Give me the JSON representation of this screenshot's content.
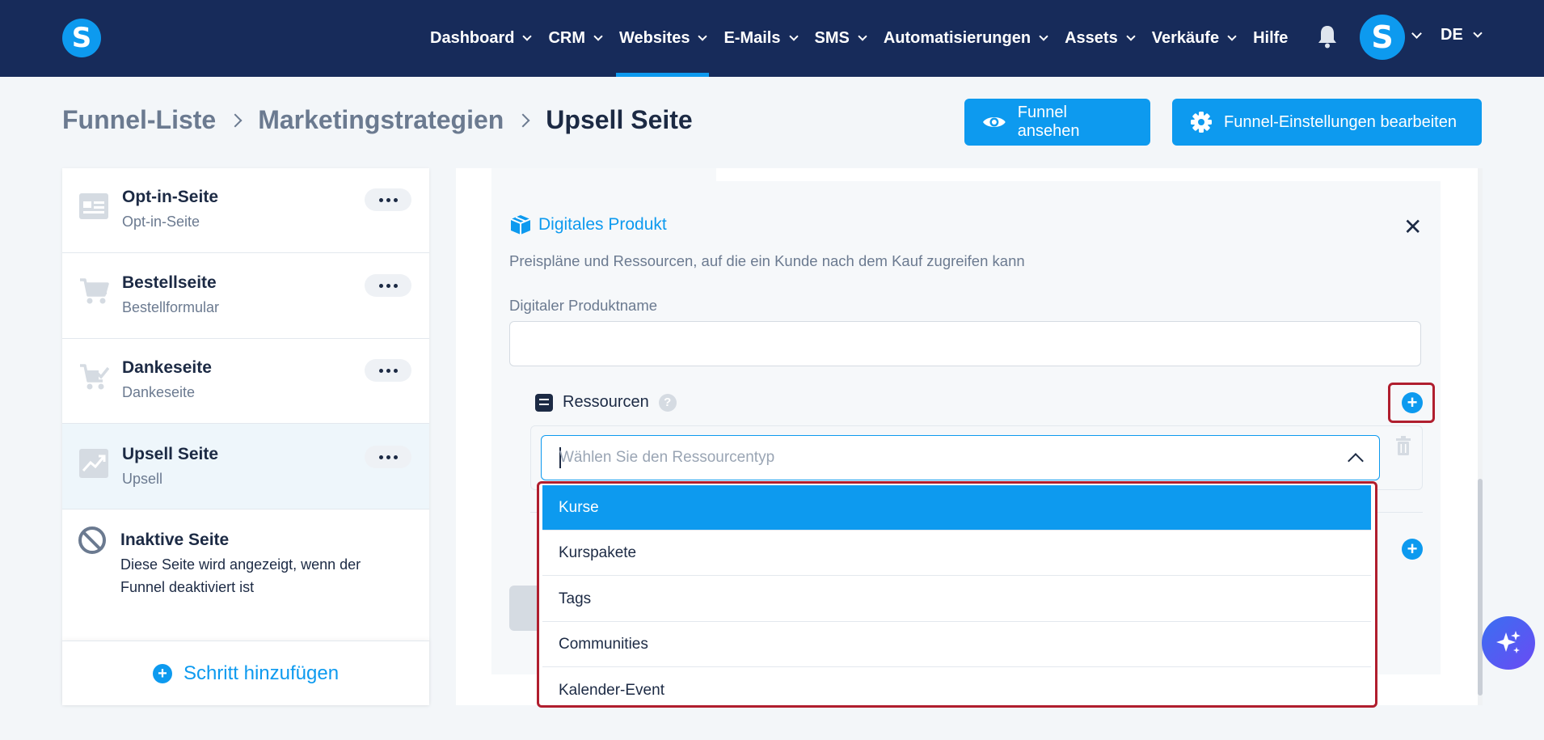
{
  "nav": {
    "items": [
      {
        "label": "Dashboard"
      },
      {
        "label": "CRM"
      },
      {
        "label": "Websites"
      },
      {
        "label": "E-Mails"
      },
      {
        "label": "SMS"
      },
      {
        "label": "Automatisierungen"
      },
      {
        "label": "Assets"
      },
      {
        "label": "Verkäufe"
      },
      {
        "label": "Hilfe"
      }
    ],
    "active": "Websites",
    "logo_letter": "S",
    "avatar_letter": "S",
    "language": "DE"
  },
  "breadcrumb": {
    "items": [
      "Funnel-Liste",
      "Marketingstrategien"
    ],
    "current": "Upsell Seite"
  },
  "actions": {
    "view_funnel": "Funnel ansehen",
    "edit_settings": "Funnel-Einstellungen bearbeiten"
  },
  "steps": [
    {
      "title": "Opt-in-Seite",
      "subtitle": "Opt-in-Seite",
      "icon": "form-page-icon"
    },
    {
      "title": "Bestellseite",
      "subtitle": "Bestellformular",
      "icon": "cart-icon"
    },
    {
      "title": "Dankeseite",
      "subtitle": "Dankeseite",
      "icon": "cart-check-icon"
    },
    {
      "title": "Upsell Seite",
      "subtitle": "Upsell",
      "icon": "trend-up-icon"
    }
  ],
  "inactive": {
    "title": "Inaktive Seite",
    "description": "Diese Seite wird angezeigt, wenn der Funnel deaktiviert ist"
  },
  "add_step": "Schritt hinzufügen",
  "product": {
    "title": "Digitales Produkt",
    "description": "Preispläne und Ressourcen, auf die ein Kunde nach dem Kauf zugreifen kann",
    "name_label": "Digitaler Produktname",
    "name_value": "",
    "resources_label": "Ressourcen",
    "select_placeholder": "Wählen Sie den Ressourcentyp",
    "options": [
      "Kurse",
      "Kurspakete",
      "Tags",
      "Communities",
      "Kalender-Event"
    ],
    "highlighted_option": "Kurse"
  },
  "colors": {
    "nav_bg": "#172b5a",
    "accent": "#0d9aef",
    "highlight_border": "#b01e2e"
  }
}
